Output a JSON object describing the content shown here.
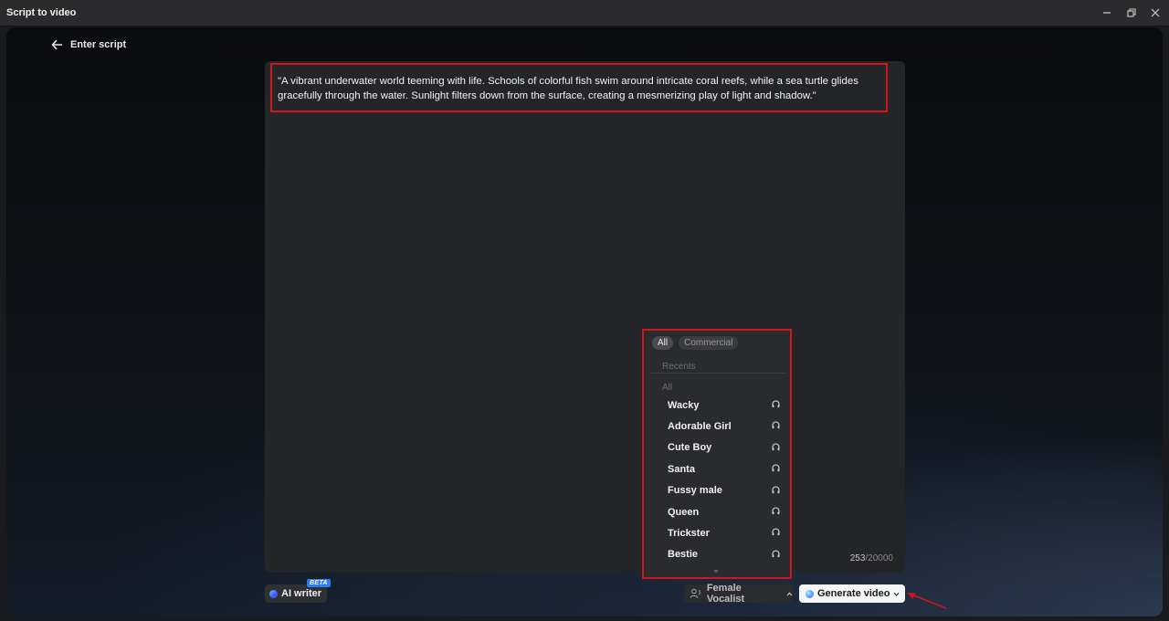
{
  "window": {
    "title": "Script to video"
  },
  "header": {
    "back_label": "Enter script"
  },
  "editor": {
    "script_text": "\"A vibrant underwater world teeming with life. Schools of colorful fish swim around intricate coral reefs, while a sea turtle glides gracefully through the water. Sunlight filters down from the surface, creating a mesmerizing play of light and shadow.\"",
    "char_count": "253",
    "char_max": "/20000"
  },
  "toolbar": {
    "ai_writer_label": "AI writer",
    "beta_badge": "BETA",
    "vocalist_label": "Female Vocalist",
    "generate_label": "Generate video"
  },
  "voice_panel": {
    "chips": [
      "All",
      "Commercial"
    ],
    "recents_label": "Recents",
    "all_label": "All",
    "voices": [
      {
        "name": "Wacky",
        "icon": "headphones-icon"
      },
      {
        "name": "Adorable Girl",
        "icon": "headphones-icon"
      },
      {
        "name": "Cute Boy",
        "icon": "headphones-icon"
      },
      {
        "name": "Santa",
        "icon": "headphones-icon"
      },
      {
        "name": "Fussy male",
        "icon": "headphones-icon"
      },
      {
        "name": "Queen",
        "icon": "headphones-icon"
      },
      {
        "name": "Trickster",
        "icon": "headphones-icon"
      },
      {
        "name": "Bestie",
        "icon": "headphones-icon"
      }
    ]
  },
  "colors": {
    "highlight_box": "#d0161b",
    "beta_badge": "#2f7cf0",
    "generate_button_bg": "#f4f5f7"
  }
}
